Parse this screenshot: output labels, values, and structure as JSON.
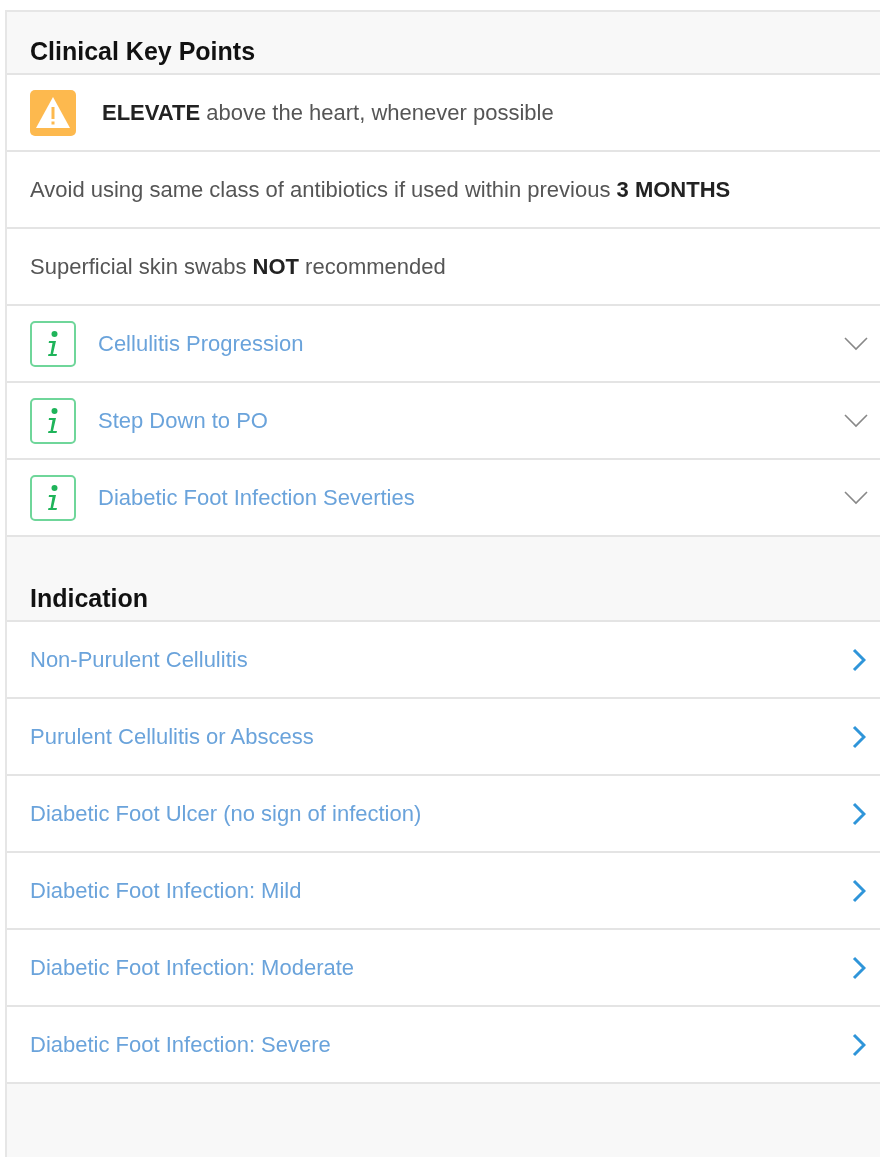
{
  "sections": [
    {
      "title": "Clinical Key Points",
      "items": [
        {
          "kind": "warning",
          "text": "**ELEVATE** above the heart, whenever possible"
        },
        {
          "kind": "note",
          "text": "Avoid using same class of antibiotics if used within previous **3 MONTHS**"
        },
        {
          "kind": "note",
          "text": "Superficial skin swabs **NOT** recommended"
        },
        {
          "kind": "expandable",
          "text": "Cellulitis Progression",
          "expanded": false
        },
        {
          "kind": "expandable",
          "text": "Step Down to PO",
          "expanded": false
        },
        {
          "kind": "expandable",
          "text": "Diabetic Foot Infection Severties",
          "expanded": false
        }
      ]
    },
    {
      "title": "Indication",
      "items": [
        {
          "kind": "link",
          "text": "Non-Purulent Cellulitis"
        },
        {
          "kind": "link",
          "text": "Purulent Cellulitis or Abscess"
        },
        {
          "kind": "link",
          "text": "Diabetic Foot Ulcer (no sign of infection)"
        },
        {
          "kind": "link",
          "text": "Diabetic Foot Infection: Mild"
        },
        {
          "kind": "link",
          "text": "Diabetic Foot Infection: Moderate"
        },
        {
          "kind": "link",
          "text": "Diabetic Foot Infection: Severe"
        }
      ]
    }
  ]
}
